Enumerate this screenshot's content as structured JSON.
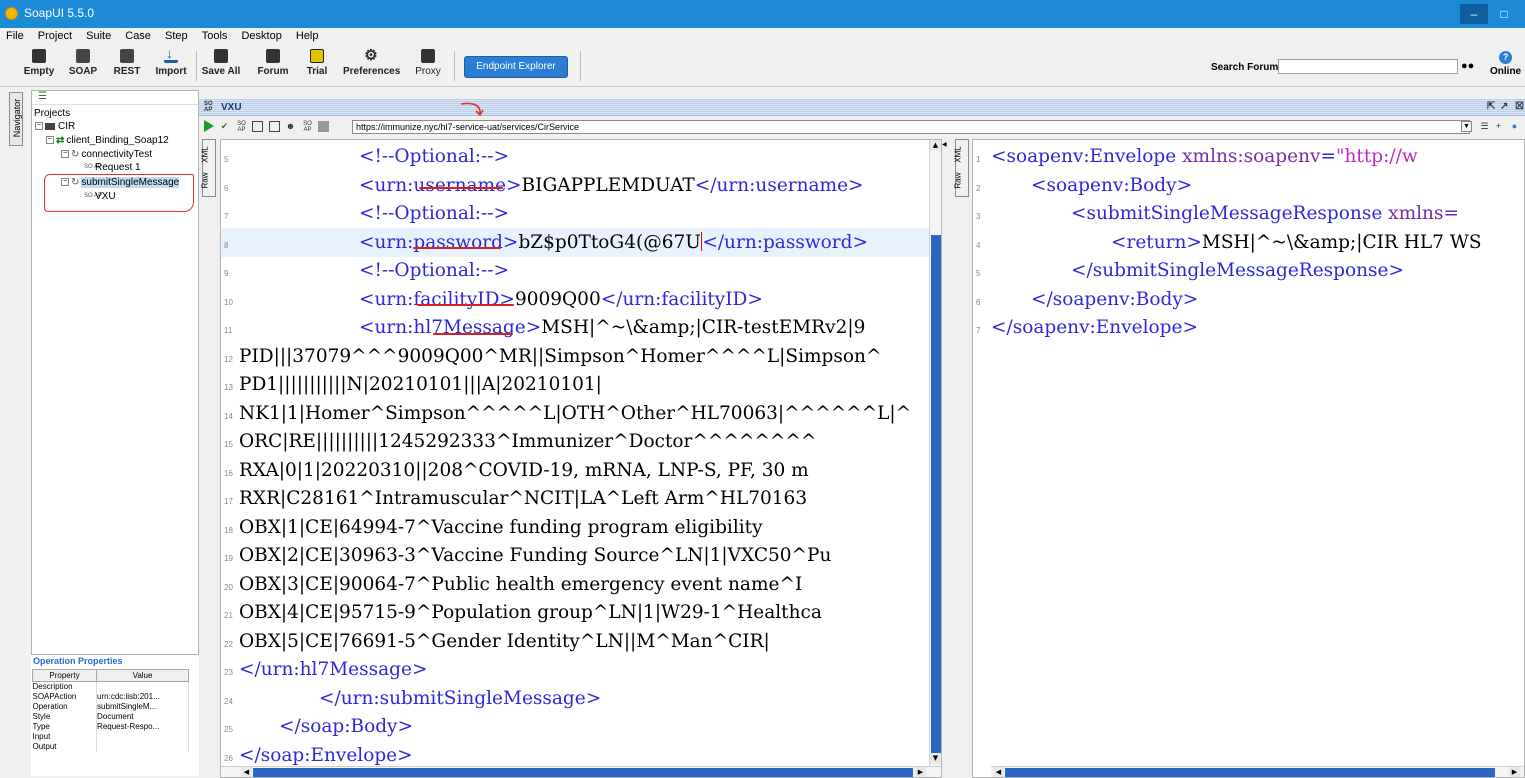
{
  "window": {
    "title": "SoapUI 5.5.0",
    "minimize": "–",
    "maximize": "□"
  },
  "menu": [
    "File",
    "Project",
    "Suite",
    "Case",
    "Step",
    "Tools",
    "Desktop",
    "Help"
  ],
  "toolbar": {
    "buttons": [
      "Empty",
      "SOAP",
      "REST",
      "Import",
      "Save All",
      "Forum",
      "Trial",
      "Preferences",
      "Proxy"
    ],
    "endpoint_explorer": "Endpoint Explorer",
    "search_label": "Search Forum",
    "search_value": "",
    "online": "Online"
  },
  "navigator": {
    "tab_label": "Navigator",
    "root": "Projects",
    "tree": [
      "CIR",
      "client_Binding_Soap12",
      "connectivityTest",
      "Request 1",
      "submitSingleMessage",
      "VXU"
    ]
  },
  "operation_properties": {
    "title": "Operation Properties",
    "columns": [
      "Property",
      "Value"
    ],
    "rows": [
      [
        "Description",
        ""
      ],
      [
        "SOAPAction",
        "urn:cdc:iisb:201..."
      ],
      [
        "Operation",
        "submitSingleM..."
      ],
      [
        "Style",
        "Document"
      ],
      [
        "Type",
        "Request-Respo..."
      ],
      [
        "Input",
        ""
      ],
      [
        "Output",
        ""
      ]
    ]
  },
  "editor": {
    "tab_title": "VXU",
    "endpoint": "https://immunize.nyc/hl7-service-uat/services/CirService",
    "request_tabs": [
      "XML",
      "Raw"
    ],
    "response_tabs": [
      "XML",
      "Raw"
    ],
    "request_lines": [
      {
        "n": "5",
        "indent": 120,
        "parts": [
          [
            "tag",
            "<!--Optional:-->"
          ]
        ]
      },
      {
        "n": "6",
        "indent": 120,
        "parts": [
          [
            "tag",
            "<urn:username>"
          ],
          [
            "txt",
            "BIGAPPLEMDUAT"
          ],
          [
            "tag",
            "</urn:username>"
          ]
        ]
      },
      {
        "n": "7",
        "indent": 120,
        "parts": [
          [
            "tag",
            "<!--Optional:-->"
          ]
        ]
      },
      {
        "n": "8",
        "indent": 120,
        "parts": [
          [
            "tag",
            "<urn:password>"
          ],
          [
            "txt",
            "bZ$p0TtoG4(@67U"
          ],
          [
            "caret",
            ""
          ],
          [
            "tag",
            "</urn:password>"
          ]
        ]
      },
      {
        "n": "9",
        "indent": 120,
        "parts": [
          [
            "tag",
            "<!--Optional:-->"
          ]
        ]
      },
      {
        "n": "10",
        "indent": 120,
        "parts": [
          [
            "tag",
            "<urn:facilityID>"
          ],
          [
            "txt",
            "9009Q00"
          ],
          [
            "tag",
            "</urn:facilityID>"
          ]
        ]
      },
      {
        "n": "11",
        "indent": 120,
        "parts": [
          [
            "tag",
            "<urn:hl7Message>"
          ],
          [
            "txt",
            "MSH|^~\\&amp;|CIR-testEMRv2|9"
          ]
        ]
      },
      {
        "n": "12",
        "indent": 0,
        "parts": [
          [
            "txt",
            "PID|||37079^^^9009Q00^MR||Simpson^Homer^^^^L|Simpson^"
          ]
        ]
      },
      {
        "n": "13",
        "indent": 0,
        "parts": [
          [
            "txt",
            "PD1|||||||||||N|20210101|||A|20210101|"
          ]
        ]
      },
      {
        "n": "14",
        "indent": 0,
        "parts": [
          [
            "txt",
            "NK1|1|Homer^Simpson^^^^^L|OTH^Other^HL70063|^^^^^^L|^"
          ]
        ]
      },
      {
        "n": "15",
        "indent": 0,
        "parts": [
          [
            "txt",
            "ORC|RE||||||||||1245292333^Immunizer^Doctor^^^^^^^^"
          ]
        ]
      },
      {
        "n": "16",
        "indent": 0,
        "parts": [
          [
            "txt",
            "RXA|0|1|20220310||208^COVID-19, mRNA, LNP-S, PF, 30 m"
          ]
        ]
      },
      {
        "n": "17",
        "indent": 0,
        "parts": [
          [
            "txt",
            "RXR|C28161^Intramuscular^NCIT|LA^Left Arm^HL70163"
          ]
        ]
      },
      {
        "n": "18",
        "indent": 0,
        "parts": [
          [
            "txt",
            "OBX|1|CE|64994-7^Vaccine funding program eligibility"
          ]
        ]
      },
      {
        "n": "19",
        "indent": 0,
        "parts": [
          [
            "txt",
            "OBX|2|CE|30963-3^Vaccine Funding Source^LN|1|VXC50^Pu"
          ]
        ]
      },
      {
        "n": "20",
        "indent": 0,
        "parts": [
          [
            "txt",
            "OBX|3|CE|90064-7^Public health emergency event name^I"
          ]
        ]
      },
      {
        "n": "21",
        "indent": 0,
        "parts": [
          [
            "txt",
            "OBX|4|CE|95715-9^Population group^LN|1|W29-1^Healthca"
          ]
        ]
      },
      {
        "n": "22",
        "indent": 0,
        "parts": [
          [
            "txt",
            "OBX|5|CE|76691-5^Gender Identity^LN||M^Man^CIR|"
          ]
        ]
      },
      {
        "n": "23",
        "indent": 0,
        "parts": [
          [
            "tag",
            "</urn:hl7Message>"
          ]
        ]
      },
      {
        "n": "24",
        "indent": 80,
        "parts": [
          [
            "tag",
            "</urn:submitSingleMessage>"
          ]
        ]
      },
      {
        "n": "25",
        "indent": 40,
        "parts": [
          [
            "tag",
            "</soap:Body>"
          ]
        ]
      },
      {
        "n": "26",
        "indent": 0,
        "parts": [
          [
            "tag",
            "</soap:Envelope>"
          ]
        ]
      }
    ],
    "response_lines": [
      {
        "n": "1",
        "indent": 0,
        "parts": [
          [
            "tag",
            "<soapenv:Envelope "
          ],
          [
            "attr",
            "xmlns:soapenv"
          ],
          [
            "tag",
            "="
          ],
          [
            "str",
            "\"http://w"
          ]
        ]
      },
      {
        "n": "2",
        "indent": 40,
        "parts": [
          [
            "tag",
            "<soapenv:Body>"
          ]
        ]
      },
      {
        "n": "3",
        "indent": 80,
        "parts": [
          [
            "tag",
            "<submitSingleMessageResponse "
          ],
          [
            "attr",
            "xmlns="
          ]
        ]
      },
      {
        "n": "4",
        "indent": 120,
        "parts": [
          [
            "tag",
            "<return>"
          ],
          [
            "txt",
            "MSH|^~\\&amp;|CIR HL7 WS"
          ]
        ]
      },
      {
        "n": "5",
        "indent": 80,
        "parts": [
          [
            "tag",
            "</submitSingleMessageResponse>"
          ]
        ]
      },
      {
        "n": "6",
        "indent": 40,
        "parts": [
          [
            "tag",
            "</soapenv:Body>"
          ]
        ]
      },
      {
        "n": "7",
        "indent": 0,
        "parts": [
          [
            "tag",
            "</soapenv:Envelope>"
          ]
        ]
      }
    ]
  }
}
